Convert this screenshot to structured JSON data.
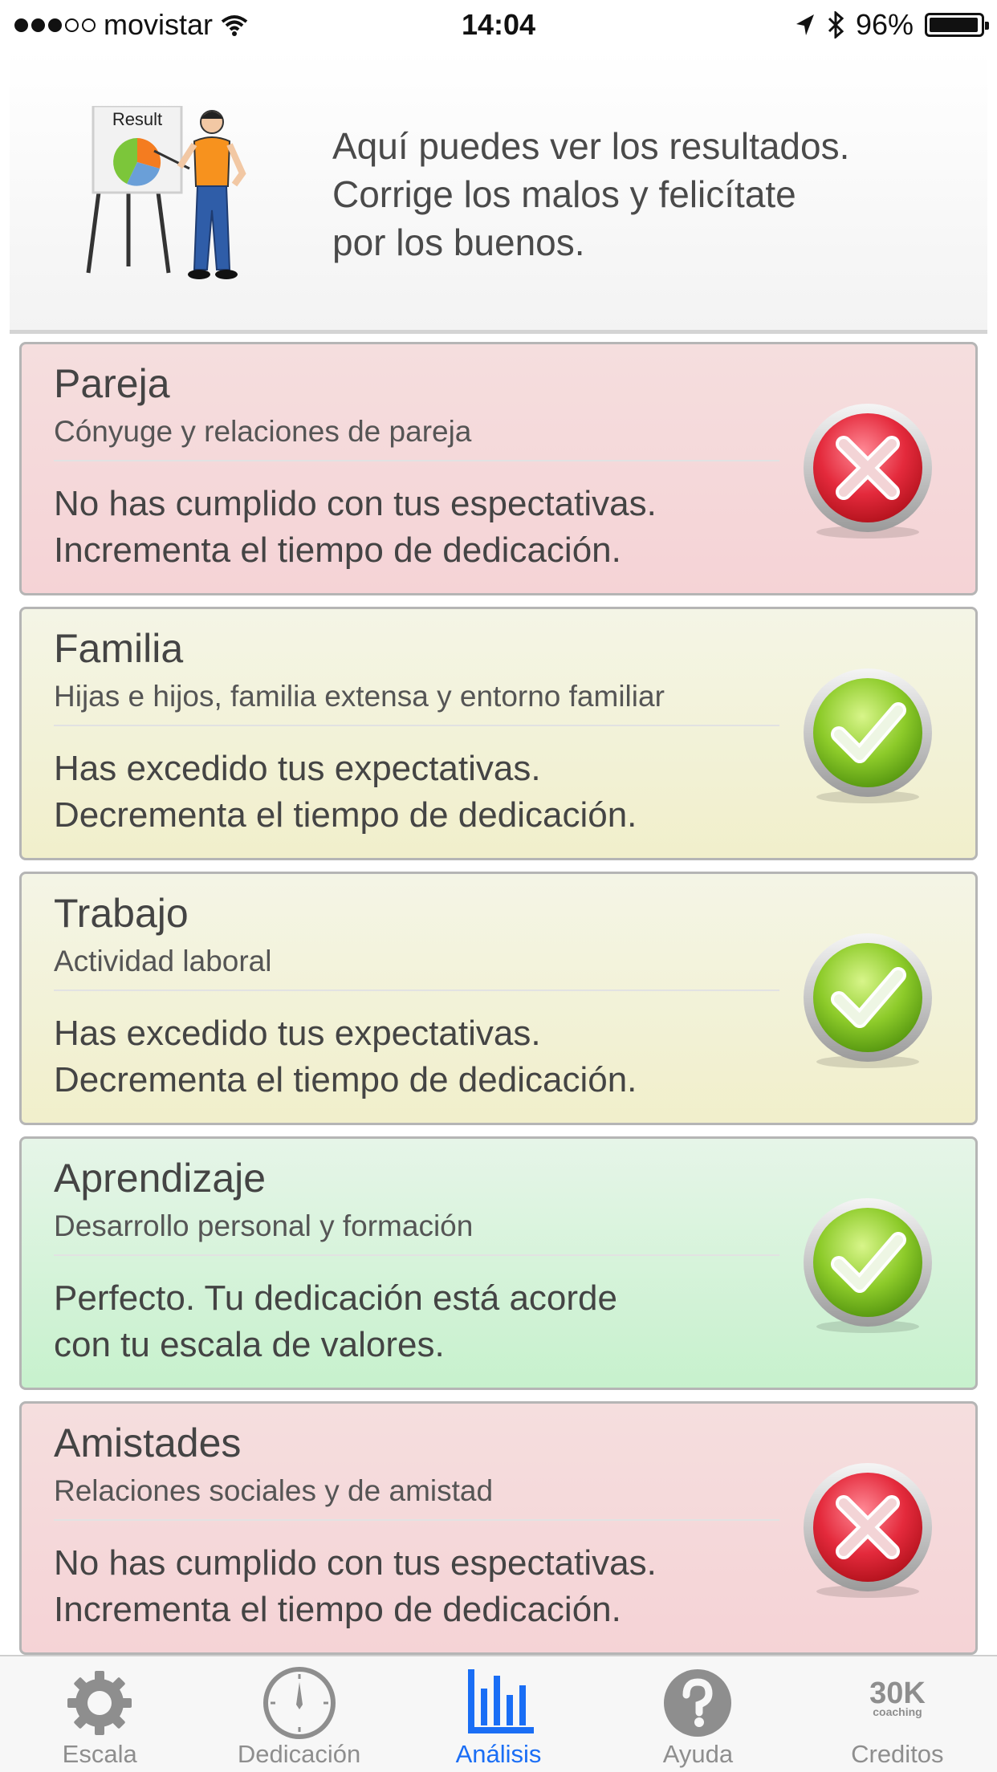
{
  "status_bar": {
    "carrier": "movistar",
    "time": "14:04",
    "battery": "96%",
    "battery_level": 0.96
  },
  "header": {
    "illustration_label": "Result",
    "intro_lines": [
      "Aquí puedes ver los resultados.",
      "Corrige los malos y felicítate",
      "por los buenos."
    ]
  },
  "cards": [
    {
      "title": "Pareja",
      "subtitle": "Cónyuge y relaciones de pareja",
      "message_lines": [
        "No has cumplido con tus espectativas.",
        "Incrementa el tiempo de dedicación."
      ],
      "status": "cross-icon",
      "color": "#f5d3d6"
    },
    {
      "title": "Familia",
      "subtitle": "Hijas e hijos, familia extensa y entorno familiar",
      "message_lines": [
        "Has excedido tus expectativas.",
        "Decrementa el tiempo de dedicación."
      ],
      "status": "check-icon",
      "color": "#f1efcb"
    },
    {
      "title": "Trabajo",
      "subtitle": "Actividad laboral",
      "message_lines": [
        "Has excedido tus expectativas.",
        "Decrementa el tiempo de dedicación."
      ],
      "status": "check-icon",
      "color": "#f1efcb"
    },
    {
      "title": "Aprendizaje",
      "subtitle": "Desarrollo personal y formación",
      "message_lines": [
        "Perfecto. Tu dedicación está acorde",
        "con tu escala de valores."
      ],
      "status": "check-icon",
      "color": "#c7f1cd"
    },
    {
      "title": "Amistades",
      "subtitle": "Relaciones sociales y de amistad",
      "message_lines": [
        "No has cumplido con tus espectativas.",
        "Incrementa el tiempo de dedicación."
      ],
      "status": "cross-icon",
      "color": "#f5d3d6"
    }
  ],
  "tab_bar": {
    "tabs": [
      {
        "label": "Escala",
        "icon": "gear-icon"
      },
      {
        "label": "Dedicación",
        "icon": "clock-icon"
      },
      {
        "label": "Análisis",
        "icon": "bar-chart-icon",
        "active": true
      },
      {
        "label": "Ayuda",
        "icon": "question-icon"
      },
      {
        "label": "Creditos",
        "icon": "logo-30k-icon",
        "logo_text": "30K",
        "logo_subtext": "coaching"
      }
    ],
    "active_color": "#1a6ef5",
    "inactive_color": "#8e8e8e"
  }
}
